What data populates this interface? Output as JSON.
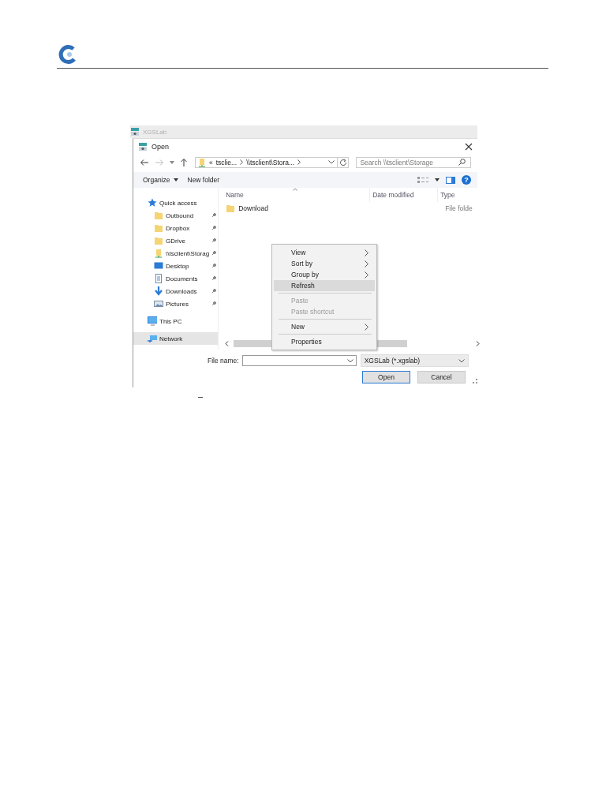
{
  "background_window": {
    "title": "XGSLab"
  },
  "dialog": {
    "title": "Open"
  },
  "address": {
    "overflow": "«",
    "crumbs": [
      "tsclie...",
      "\\\\tsclient\\Stora..."
    ]
  },
  "search": {
    "placeholder": "Search \\\\tsclient\\Storage"
  },
  "toolbar": [
    {
      "label": "Organize",
      "dropdown": true
    },
    {
      "label": "New folder",
      "dropdown": false
    }
  ],
  "help": "?",
  "sidebar": {
    "items": [
      {
        "label": "Quick access",
        "kind": "star",
        "pinned": false,
        "selected": false
      },
      {
        "label": "Outbound",
        "kind": "folder",
        "pinned": true,
        "selected": false
      },
      {
        "label": "Dropbox",
        "kind": "folder",
        "pinned": true,
        "selected": false
      },
      {
        "label": "GDrive",
        "kind": "folder",
        "pinned": true,
        "selected": false
      },
      {
        "label": "\\\\tsclient\\Storag",
        "kind": "netdrive",
        "pinned": true,
        "selected": false
      },
      {
        "label": "Desktop",
        "kind": "desktop",
        "pinned": true,
        "selected": false
      },
      {
        "label": "Documents",
        "kind": "documents",
        "pinned": true,
        "selected": false
      },
      {
        "label": "Downloads",
        "kind": "downloads",
        "pinned": true,
        "selected": false
      },
      {
        "label": "Pictures",
        "kind": "pictures",
        "pinned": true,
        "selected": false
      },
      {
        "label": "This PC",
        "kind": "pc",
        "pinned": false,
        "selected": false
      },
      {
        "label": "Network",
        "kind": "network",
        "pinned": false,
        "selected": true
      }
    ]
  },
  "columns": [
    {
      "label": "Name",
      "sorted": true
    },
    {
      "label": "Date modified",
      "sorted": false
    },
    {
      "label": "Type",
      "sorted": false
    }
  ],
  "rows": [
    {
      "name": "Download",
      "type": "File folde"
    }
  ],
  "file_name": {
    "label": "File name:"
  },
  "file_type": {
    "value": "XGSLab (*.xgslab)"
  },
  "buttons": [
    {
      "label": "Open",
      "default": true
    },
    {
      "label": "Cancel",
      "default": false
    }
  ],
  "context_menu": {
    "items": [
      {
        "kind": "item",
        "label": "View",
        "submenu": true,
        "disabled": false,
        "selected": false
      },
      {
        "kind": "item",
        "label": "Sort by",
        "submenu": true,
        "disabled": false,
        "selected": false
      },
      {
        "kind": "item",
        "label": "Group by",
        "submenu": true,
        "disabled": false,
        "selected": false
      },
      {
        "kind": "item",
        "label": "Refresh",
        "submenu": false,
        "disabled": false,
        "selected": true
      },
      {
        "kind": "separator"
      },
      {
        "kind": "item",
        "label": "Paste",
        "submenu": false,
        "disabled": true,
        "selected": false
      },
      {
        "kind": "item",
        "label": "Paste shortcut",
        "submenu": false,
        "disabled": true,
        "selected": false
      },
      {
        "kind": "separator"
      },
      {
        "kind": "item",
        "label": "New",
        "submenu": true,
        "disabled": false,
        "selected": false
      },
      {
        "kind": "separator"
      },
      {
        "kind": "item",
        "label": "Properties",
        "submenu": false,
        "disabled": false,
        "selected": false
      }
    ]
  }
}
